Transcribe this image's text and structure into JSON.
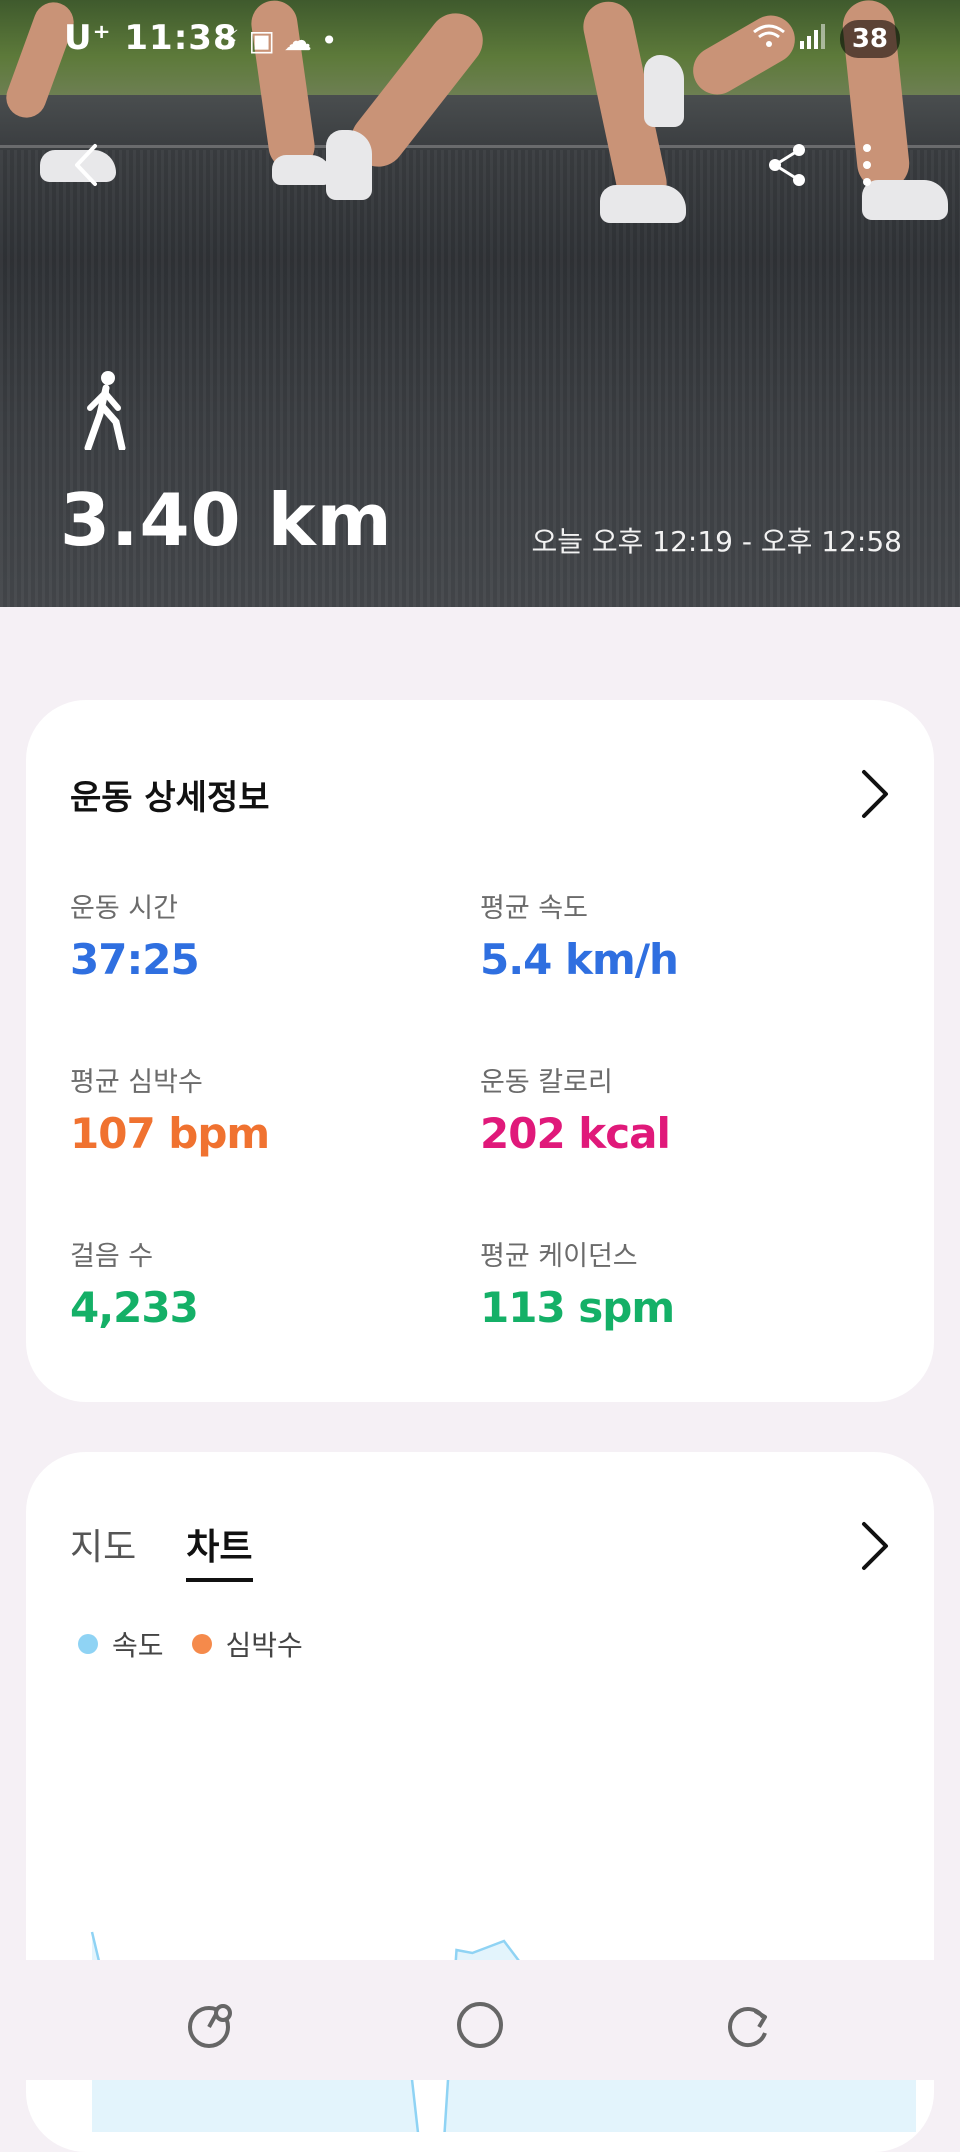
{
  "status_bar": {
    "carrier_time": "U⁺ 11:38",
    "battery": "38"
  },
  "header": {
    "distance": "3.40 km",
    "time_range": "오늘 오후 12:19 - 오후 12:58"
  },
  "details": {
    "title": "운동 상세정보",
    "metrics": [
      {
        "label": "운동 시간",
        "value": "37:25",
        "color": "#2f6fe0"
      },
      {
        "label": "평균 속도",
        "value": "5.4 km/h",
        "color": "#2f6fe0"
      },
      {
        "label": "평균 심박수",
        "value": "107 bpm",
        "color": "#f07230"
      },
      {
        "label": "운동 칼로리",
        "value": "202 kcal",
        "color": "#e0197a"
      },
      {
        "label": "걸음 수",
        "value": "4,233",
        "color": "#14b067"
      },
      {
        "label": "평균 케이던스",
        "value": "113 spm",
        "color": "#14b067"
      }
    ]
  },
  "chart_card": {
    "tabs": [
      "지도",
      "차트"
    ],
    "active_tab": "차트",
    "legend": [
      {
        "name": "속도",
        "color": "#8fd3f4"
      },
      {
        "name": "심박수",
        "color": "#f58a4b"
      }
    ]
  },
  "chart_data": {
    "type": "area",
    "series": [
      {
        "name": "속도",
        "color": "#8fd3f4",
        "values": [
          90,
          68,
          68,
          68,
          66,
          62,
          61,
          63,
          62,
          58,
          57,
          59,
          57,
          55,
          55,
          56,
          52,
          54,
          55,
          55,
          50,
          3,
          3,
          84,
          83,
          85,
          87,
          80,
          76,
          78,
          80,
          72,
          77,
          74,
          75,
          74,
          75,
          75,
          74,
          75,
          74,
          74,
          72,
          74,
          76,
          75,
          74,
          72,
          70,
          72,
          75,
          71,
          68
        ]
      }
    ],
    "ylim": [
      0,
      100
    ],
    "xlabel": "",
    "ylabel": ""
  }
}
